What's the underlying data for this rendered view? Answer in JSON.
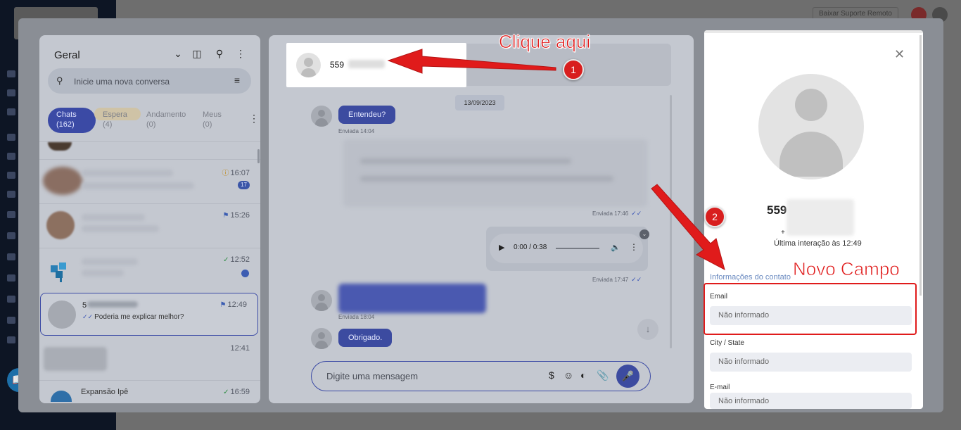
{
  "background": {
    "remote_support_label": "Baixar Suporte Remoto"
  },
  "left_panel": {
    "title": "Geral",
    "search_placeholder": "Inicie uma nova conversa",
    "tabs": [
      {
        "label": "Chats",
        "count": "(162)"
      },
      {
        "label": "Espera",
        "count": "(4)"
      },
      {
        "label": "Andamento",
        "count": "(0)"
      },
      {
        "label": "Meus",
        "count": "(0)"
      }
    ],
    "conversations": [
      {
        "time": "16:07",
        "badge": "17"
      },
      {
        "time": "15:26"
      },
      {
        "time": "12:52"
      },
      {
        "name": "5",
        "time": "12:49",
        "message": "Poderia me explicar melhor?"
      },
      {
        "time": "12:41"
      },
      {
        "name": "Expansão Ipê",
        "time": "16:59"
      }
    ]
  },
  "chat": {
    "header_number": "559",
    "date_chip": "13/09/2023",
    "messages": [
      {
        "text": "Entendeu?",
        "meta": "Enviada 14:04"
      },
      {
        "meta": "Enviada 17:46"
      },
      {
        "meta": "Enviada 17:47"
      },
      {
        "meta": "Enviada 18:04"
      },
      {
        "text": "Obrigado."
      }
    ],
    "audio_time": "0:00 / 0:38",
    "composer_placeholder": "Digite uma mensagem"
  },
  "contact": {
    "name_prefix": "559",
    "plus": "+",
    "last_interaction": "Última interação às 12:49",
    "section_title": "Informações do contato",
    "fields": [
      {
        "label": "Email",
        "value": "Não informado"
      },
      {
        "label": "City / State",
        "value": "Não informado"
      },
      {
        "label": "E-mail",
        "value": "Não informado"
      }
    ]
  },
  "annotations": {
    "click_here": "Clique aqui",
    "new_field": "Novo Campo",
    "step1": "1",
    "step2": "2"
  },
  "colors": {
    "accent": "#3b4aa5",
    "annotation_red": "#e01b1b"
  }
}
